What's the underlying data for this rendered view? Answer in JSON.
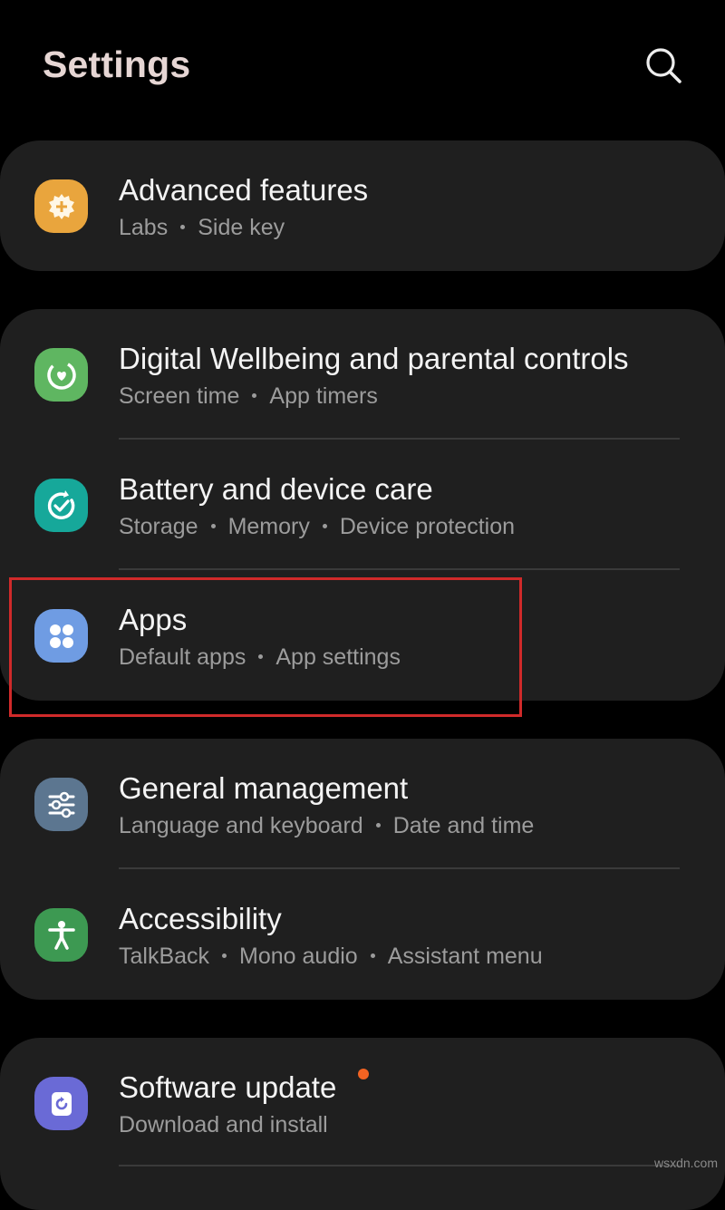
{
  "header": {
    "title": "Settings"
  },
  "cards": [
    {
      "items": [
        {
          "name": "advanced-features",
          "icon": "gear-plus-icon",
          "icon_color": "#e9a53d",
          "title": "Advanced features",
          "subs": [
            "Labs",
            "Side key"
          ]
        }
      ]
    },
    {
      "items": [
        {
          "name": "digital-wellbeing",
          "icon": "wellbeing-heart-icon",
          "icon_color": "#5fb661",
          "title": "Digital Wellbeing and parental controls",
          "subs": [
            "Screen time",
            "App timers"
          ]
        },
        {
          "name": "battery-device-care",
          "icon": "device-care-icon",
          "icon_color": "#16a89a",
          "title": "Battery and device care",
          "subs": [
            "Storage",
            "Memory",
            "Device protection"
          ]
        },
        {
          "name": "apps",
          "icon": "apps-grid-icon",
          "icon_color": "#6f9ce3",
          "title": "Apps",
          "subs": [
            "Default apps",
            "App settings"
          ]
        }
      ]
    },
    {
      "items": [
        {
          "name": "general-management",
          "icon": "sliders-icon",
          "icon_color": "#5c7690",
          "title": "General management",
          "subs": [
            "Language and keyboard",
            "Date and time"
          ]
        },
        {
          "name": "accessibility",
          "icon": "accessibility-person-icon",
          "icon_color": "#3d9952",
          "title": "Accessibility",
          "subs": [
            "TalkBack",
            "Mono audio",
            "Assistant menu"
          ]
        }
      ]
    },
    {
      "items": [
        {
          "name": "software-update",
          "icon": "software-update-icon",
          "icon_color": "#6a6ad6",
          "title": "Software update",
          "subs": [
            "Download and install"
          ],
          "badge": true
        }
      ]
    }
  ],
  "highlight_color": "#d02a2a",
  "badge_color": "#f26322",
  "watermark": "wsxdn.com"
}
